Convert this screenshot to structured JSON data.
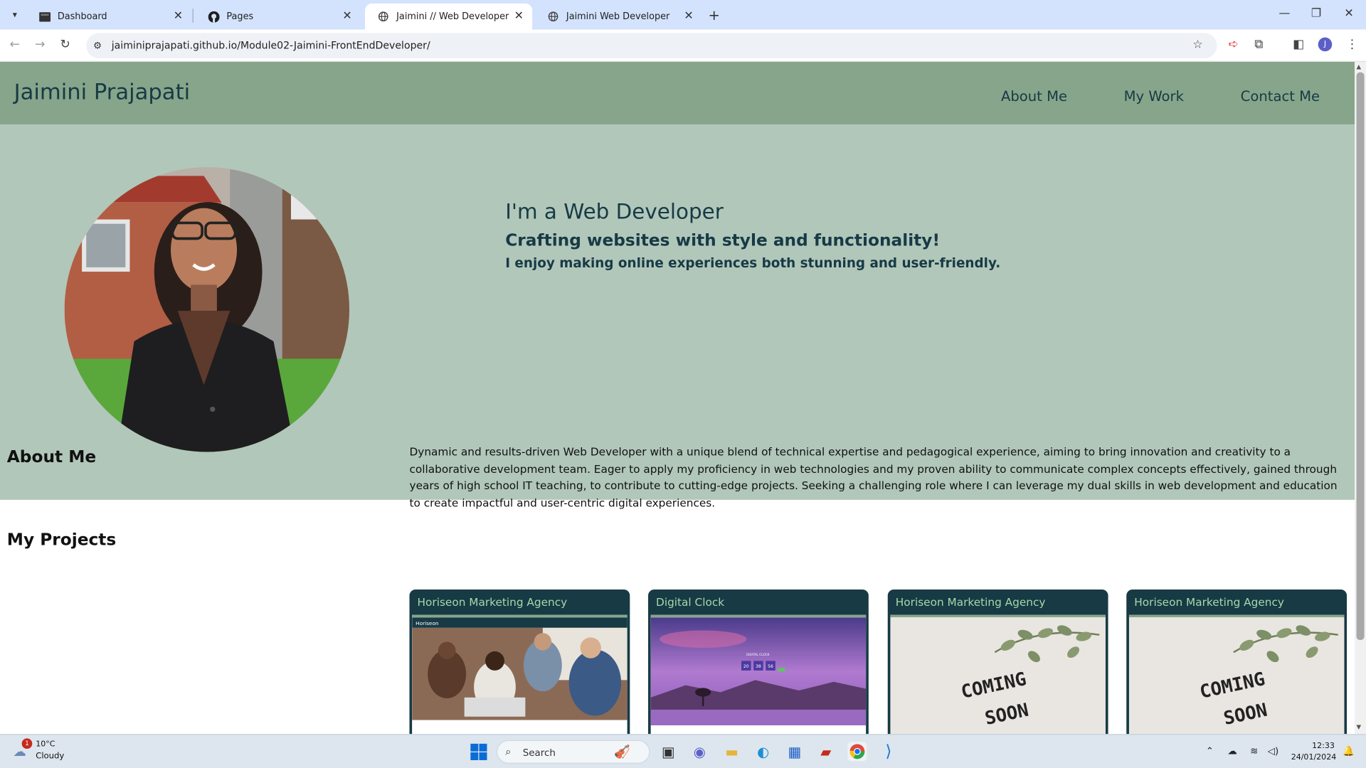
{
  "browser": {
    "tabs": [
      {
        "title": "Dashboard",
        "icon": "dashboard-favicon",
        "active": false
      },
      {
        "title": "Pages",
        "icon": "github-icon",
        "active": false
      },
      {
        "title": "Jaimini // Web Developer",
        "icon": "globe-icon",
        "active": true
      },
      {
        "title": "Jaimini Web Developer",
        "icon": "globe-icon",
        "active": false
      }
    ],
    "url": "jaiminiprajapati.github.io/Module02-Jaimini-FrontEndDeveloper/",
    "profile_initial": "J"
  },
  "site": {
    "title": "Jaimini Prajapati",
    "nav": [
      "About Me",
      "My Work",
      "Contact Me"
    ],
    "hero": {
      "heading": "I'm a Web Developer",
      "subheading": "Crafting websites with style and functionality!",
      "tagline": "I enjoy making online experiences both stunning and user-friendly."
    },
    "about": {
      "heading": "About Me",
      "text": "Dynamic and results-driven Web Developer with a unique blend of technical expertise and pedagogical experience, aiming to bring innovation and creativity to a collaborative development team. Eager to apply my proficiency in web technologies and my proven ability to communicate complex concepts effectively, gained through years of high school IT teaching, to contribute to cutting-edge projects. Seeking a challenging role where I can leverage my dual skills in web development and education to create impactful and user-centric digital experiences."
    },
    "projects": {
      "heading": "My Projects",
      "cards": [
        {
          "title": "Horiseon Marketing Agency",
          "thumb_label": "Horiseon"
        },
        {
          "title": "Digital Clock",
          "thumb_label": "DIGITAL CLOCK",
          "clock_digits": [
            "20",
            "38",
            "56"
          ]
        },
        {
          "title": "Horiseon Marketing Agency",
          "thumb_line1": "COMING",
          "thumb_line2": "SOON"
        },
        {
          "title": "Horiseon Marketing Agency",
          "thumb_line1": "COMING",
          "thumb_line2": "SOON"
        }
      ]
    }
  },
  "taskbar": {
    "weather": {
      "temp": "10°C",
      "condition": "Cloudy",
      "badge": "1"
    },
    "search_placeholder": "Search",
    "time": "12:33",
    "date": "24/01/2024"
  },
  "colors": {
    "header": "#87a58a",
    "hero": "#b1c7ba",
    "text_dark": "#173a45",
    "card_bg": "#173a45",
    "card_title": "#a7d8a9"
  }
}
